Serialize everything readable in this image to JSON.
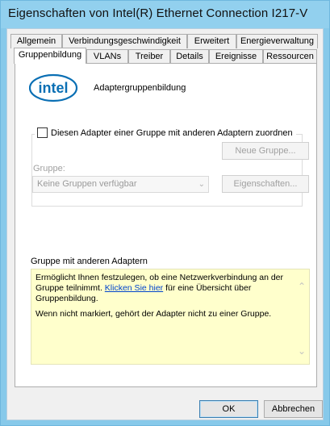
{
  "window": {
    "title": "Eigenschaften von Intel(R) Ethernet Connection I217-V"
  },
  "tabs_row1": [
    {
      "label": "Allgemein"
    },
    {
      "label": "Verbindungsgeschwindigkeit"
    },
    {
      "label": "Erweitert"
    },
    {
      "label": "Energieverwaltung"
    }
  ],
  "tabs_row2": [
    {
      "label": "Gruppenbildung",
      "active": true
    },
    {
      "label": "VLANs"
    },
    {
      "label": "Treiber"
    },
    {
      "label": "Details"
    },
    {
      "label": "Ereignisse"
    },
    {
      "label": "Ressourcen"
    }
  ],
  "panel": {
    "logo_text": "intel",
    "heading": "Adaptergruppenbildung",
    "team_checkbox_label": "Diesen Adapter einer Gruppe mit anderen Adaptern zuordnen",
    "team_checkbox_checked": false,
    "group_label": "Gruppe:",
    "group_select_value": "Keine Gruppen verfügbar",
    "new_group_button": "Neue Gruppe...",
    "properties_button": "Eigenschaften...",
    "info_section_label": "Gruppe mit anderen Adaptern",
    "info_text_before_link": "Ermöglicht Ihnen festzulegen, ob eine Netzwerkverbindung an der Gruppe teilnimmt.",
    "info_link": "Klicken Sie hier",
    "info_text_after_link": "für eine Übersicht über Gruppenbildung.",
    "info_text_2": "Wenn nicht markiert, gehört der Adapter nicht zu einer Gruppe."
  },
  "footer": {
    "ok_label": "OK",
    "cancel_label": "Abbrechen"
  },
  "colors": {
    "window_frame": "#87c9ea",
    "info_background": "#ffffcc",
    "intel_blue": "#0a6fb4",
    "link": "#0044cc"
  }
}
